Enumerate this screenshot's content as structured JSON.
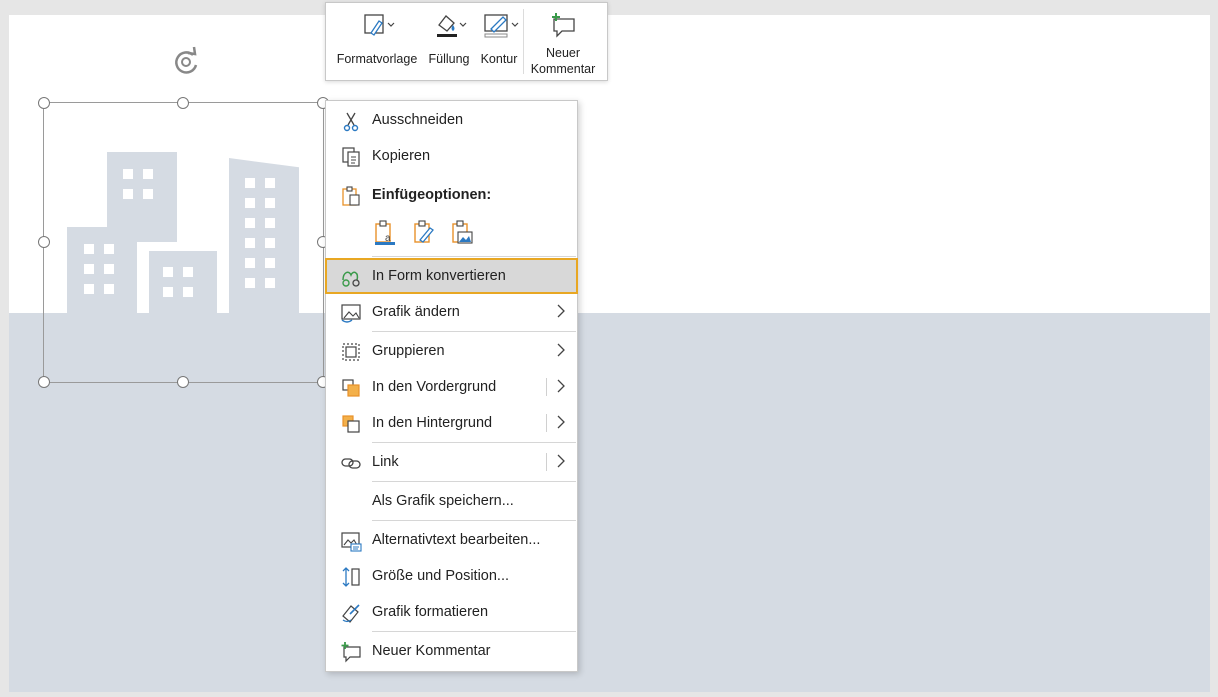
{
  "mini_toolbar": {
    "style": "Formatvorlage",
    "fill": "Füllung",
    "outline": "Kontur",
    "new_comment_line1": "Neuer",
    "new_comment_line2": "Kommentar"
  },
  "menu": {
    "cut": "Ausschneiden",
    "copy": "Kopieren",
    "paste_options": "Einfügeoptionen:",
    "convert": "In Form konvertieren",
    "change_graphic": "Grafik ändern",
    "group": "Gruppieren",
    "bring_forward": "In den Vordergrund",
    "send_backward": "In den Hintergrund",
    "link": "Link",
    "save_as_graphic": "Als Grafik speichern...",
    "alt_text": "Alternativtext bearbeiten...",
    "size_position": "Größe und Position...",
    "format_graphic": "Grafik formatieren",
    "new_comment": "Neuer Kommentar"
  },
  "colors": {
    "accent_highlight": "#e8a723",
    "slide_band": "#d5dbe3",
    "icon_blue": "#2b79c2",
    "icon_orange": "#e8912a",
    "icon_green": "#3a9a4a"
  }
}
